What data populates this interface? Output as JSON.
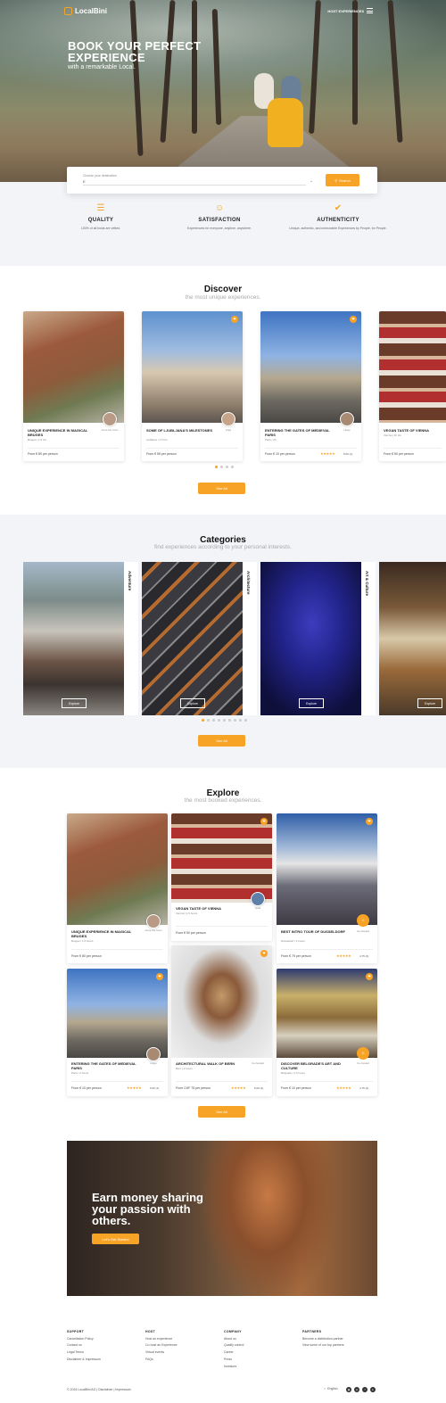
{
  "header": {
    "logo": "LocalBini",
    "nav_label": "HOST EXPERIENCES",
    "hero_title": "BOOK YOUR PERFECT EXPERIENCE",
    "hero_subtitle": "with a remarkable Local."
  },
  "search": {
    "label": "Choose your destination",
    "value": "Е",
    "button": "Search"
  },
  "features": [
    {
      "icon": "shield-check-icon",
      "title": "QUALITY",
      "desc": "100% of all hosts are vetted."
    },
    {
      "icon": "smile-icon",
      "title": "SATISFACTION",
      "desc": "Experiences for everyone, anytime, anywhere."
    },
    {
      "icon": "check-circle-icon",
      "title": "AUTHENTICITY",
      "desc": "Unique, authentic, and memorable Experiences by People, for People."
    }
  ],
  "discover": {
    "title": "Discover",
    "subtitle": "the most unique experiences.",
    "see_all": "See All",
    "cards": [
      {
        "title": "UNIQUE EXPERIENCE IN MAGICAL BRUGES",
        "meta": "Bruges | 1.5 hrs",
        "price": "From € 80 per person",
        "host": "Anne De Cam"
      },
      {
        "title": "SOME OF LJUBLJANA'S MILESTONES",
        "meta": "Ljubljana | 1.5 hrs",
        "price": "From € 55 per person",
        "host": "Anja"
      },
      {
        "title": "ENTERING THE GATES OF MEDIEVAL PARIS",
        "meta": "Paris | 2h",
        "price": "From € 10 per person",
        "host": "Hugo",
        "rating": "5.00 (1)"
      },
      {
        "title": "VEGAN TASTE OF VIENNA",
        "meta": "Vienna | 1h 3m",
        "price": "From € 50 per person"
      }
    ]
  },
  "categories": {
    "title": "Categories",
    "subtitle": "find experiences according to your personal interests.",
    "explore": "Explore",
    "see_all": "See All",
    "items": [
      {
        "name": "Adventure"
      },
      {
        "name": "Architecture"
      },
      {
        "name": "Art & Culture"
      },
      {
        "name": ""
      }
    ]
  },
  "explore": {
    "title": "Explore",
    "subtitle": "the most booked experiences.",
    "see_all": "See All",
    "cards": [
      {
        "title": "UNIQUE EXPERIENCE IN MAGICAL BRUGES",
        "meta": "Bruges | 1.5 hours",
        "price": "From € 80 per person",
        "host": "Anne De Cam"
      },
      {
        "title": "VEGAN TASTE OF VIENNA",
        "meta": "Vienna | 1.5 hours",
        "price": "From € 50 per person",
        "host": "Julia"
      },
      {
        "title": "BEST INTRO TOUR OF DUSSELDORF",
        "meta": "Düsseldorf | 2 hours",
        "price": "From € 75 per person",
        "host": "Co-hosted",
        "rating": "4.75 (4)"
      },
      {
        "title": "ENTERING THE GATES OF MEDIEVAL PARIS",
        "meta": "Paris | 2 hours",
        "price": "From € 10 per person",
        "host": "Hugo",
        "rating": "5.00 (1)"
      },
      {
        "title": "ARCHITECTURAL WALK OF BERN",
        "meta": "Bern | 2 hours",
        "price": "From CHF 75 per person",
        "host": "Co-hosted",
        "rating": "5.00 (2)"
      },
      {
        "title": "DISCOVER BELGRADE'S ART AND CULTURE",
        "meta": "Belgrade | 1.5 hours",
        "price": "From € 10 per person",
        "host": "Co-hosted",
        "rating": "4.75 (2)"
      }
    ]
  },
  "promo": {
    "title": "Earn money sharing your passion with others.",
    "button": "Let's Get Started"
  },
  "footer": {
    "columns": [
      {
        "head": "SUPPORT",
        "links": [
          "Cancellation Policy",
          "Contact us",
          "Legal Terms",
          "Disclaimer & Impressum"
        ]
      },
      {
        "head": "HOST",
        "links": [
          "Host an experience",
          "Co-host an Experience",
          "Virtual events",
          "FAQs"
        ]
      },
      {
        "head": "COMPANY",
        "links": [
          "About us",
          "Quality control",
          "Career",
          "Press",
          "Investors"
        ]
      },
      {
        "head": "PARTNERS",
        "links": [
          "Become a distribution partner",
          "View some of our top partners"
        ]
      }
    ],
    "copyright": "© 2024 LocalBini AG | Disclaimer | Impressum",
    "language": "English"
  },
  "colors": {
    "accent": "#f7a325",
    "band": "#f2f4f7"
  }
}
